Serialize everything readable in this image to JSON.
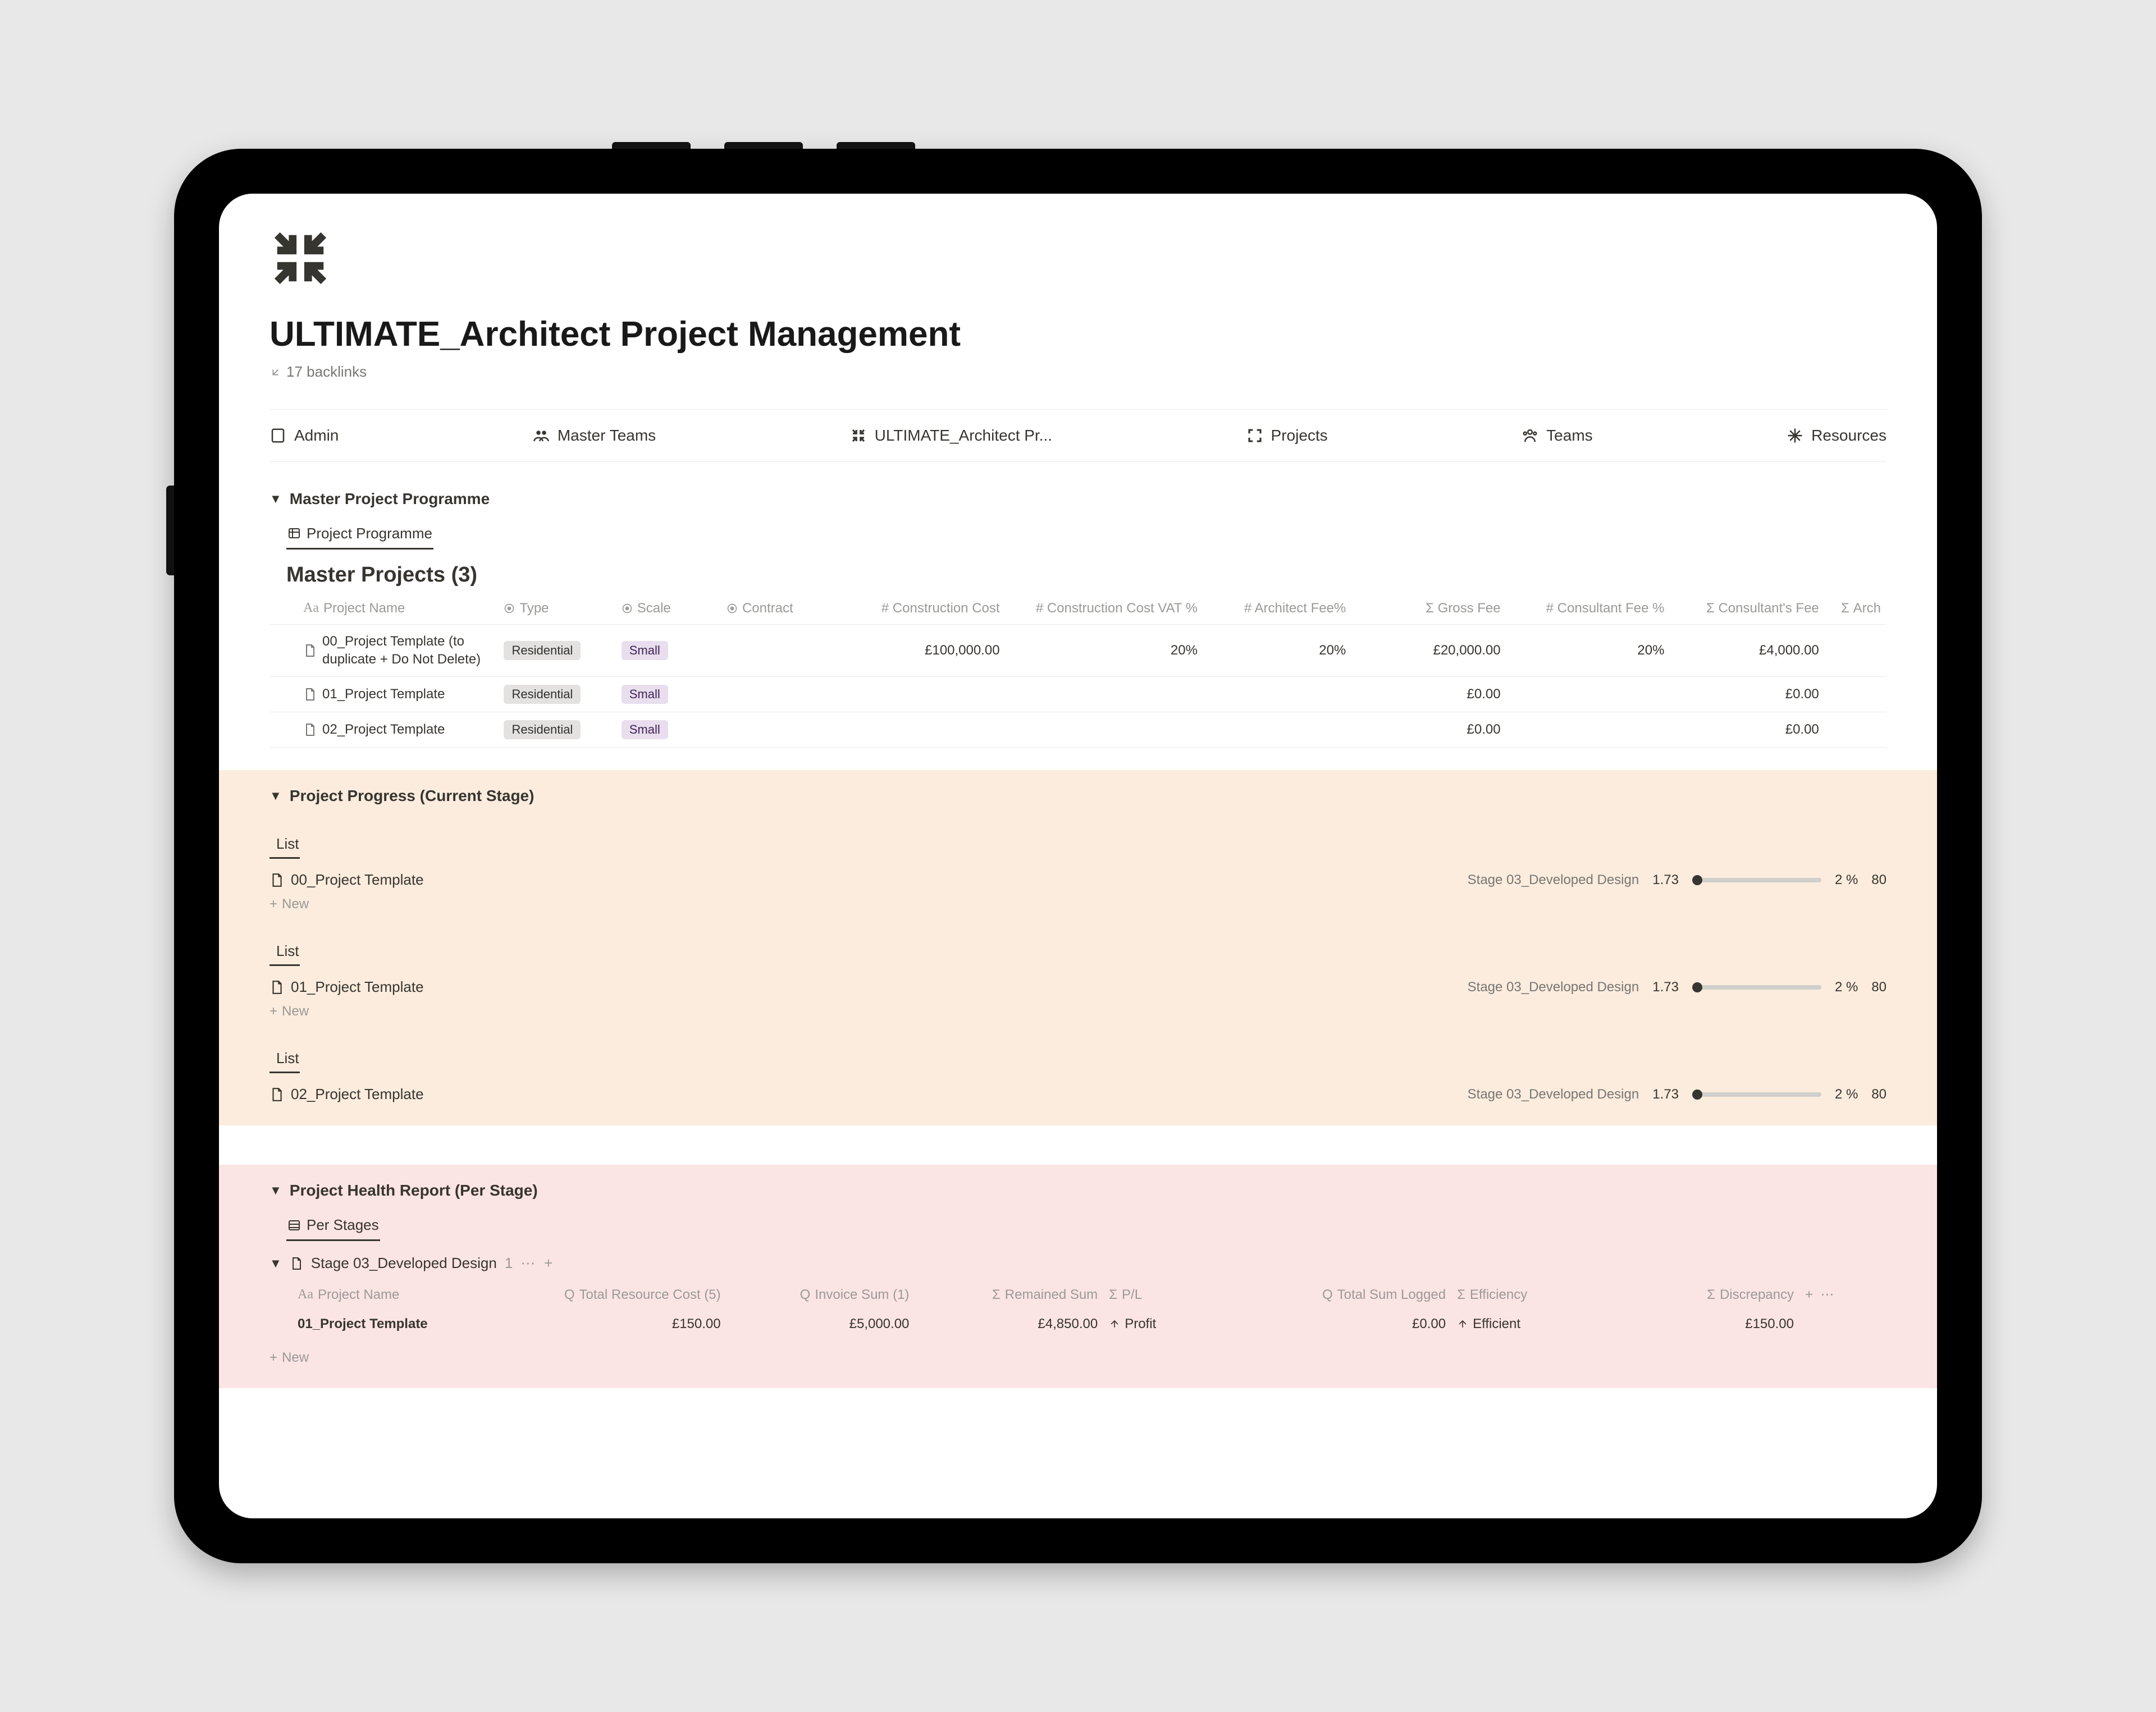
{
  "page": {
    "title": "ULTIMATE_Architect Project Management",
    "backlinks": "17 backlinks"
  },
  "nav": [
    {
      "label": "Admin",
      "icon": "page-icon"
    },
    {
      "label": "Master Teams",
      "icon": "people-icon"
    },
    {
      "label": "ULTIMATE_Architect Pr...",
      "icon": "collapse-icon"
    },
    {
      "label": "Projects",
      "icon": "expand-icon"
    },
    {
      "label": "Teams",
      "icon": "team-icon"
    },
    {
      "label": "Resources",
      "icon": "snow-icon"
    }
  ],
  "masterProgramme": {
    "sectionTitle": "Master Project Programme",
    "tab": "Project Programme",
    "groupTitle": "Master Projects (3)",
    "columns": [
      "Project Name",
      "Type",
      "Scale",
      "Contract",
      "Construction Cost",
      "Construction Cost VAT %",
      "Architect Fee%",
      "Gross Fee",
      "Consultant Fee %",
      "Consultant's Fee",
      "Arch"
    ],
    "rows": [
      {
        "name": "00_Project Template (to duplicate + Do Not Delete)",
        "type": "Residential",
        "scale": "Small",
        "contract": "",
        "constructionCost": "£100,000.00",
        "vatPct": "20%",
        "archFeePct": "20%",
        "grossFee": "£20,000.00",
        "consultFeePct": "20%",
        "consultFee": "£4,000.00"
      },
      {
        "name": "01_Project Template",
        "type": "Residential",
        "scale": "Small",
        "contract": "",
        "constructionCost": "",
        "vatPct": "",
        "archFeePct": "",
        "grossFee": "£0.00",
        "consultFeePct": "",
        "consultFee": "£0.00"
      },
      {
        "name": "02_Project Template",
        "type": "Residential",
        "scale": "Small",
        "contract": "",
        "constructionCost": "",
        "vatPct": "",
        "archFeePct": "",
        "grossFee": "£0.00",
        "consultFeePct": "",
        "consultFee": "£0.00"
      }
    ]
  },
  "progress": {
    "sectionTitle": "Project Progress (Current Stage)",
    "listTab": "List",
    "newLabel": "New",
    "items": [
      {
        "name": "00_Project Template",
        "stage": "Stage 03_Developed Design",
        "value": "1.73",
        "pct": "2 %",
        "last": "80"
      },
      {
        "name": "01_Project Template",
        "stage": "Stage 03_Developed Design",
        "value": "1.73",
        "pct": "2 %",
        "last": "80"
      },
      {
        "name": "02_Project Template",
        "stage": "Stage 03_Developed Design",
        "value": "1.73",
        "pct": "2 %",
        "last": "80"
      }
    ]
  },
  "health": {
    "sectionTitle": "Project Health Report (Per Stage)",
    "tab": "Per Stages",
    "groupName": "Stage 03_Developed Design",
    "groupCount": "1",
    "columns": [
      "Project Name",
      "Total Resource Cost (5)",
      "Invoice Sum (1)",
      "Remained Sum",
      "P/L",
      "Total Sum Logged",
      "Efficiency",
      "Discrepancy"
    ],
    "rows": [
      {
        "name": "01_Project Template",
        "resourceCost": "£150.00",
        "invoiceSum": "£5,000.00",
        "remained": "£4,850.00",
        "pl": "Profit",
        "logged": "£0.00",
        "efficiency": "Efficient",
        "discrepancy": "£150.00"
      }
    ],
    "newLabel": "New"
  }
}
